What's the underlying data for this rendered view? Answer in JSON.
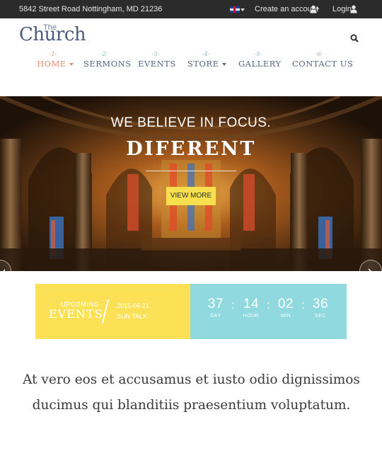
{
  "topbar": {
    "address": "5842 Street Road Nottingham, MD 21236",
    "language_icon": "uk-flag-icon",
    "create_account": "Create an account",
    "create_account_icon": "add-user-icon",
    "login": "Login",
    "login_icon": "user-icon"
  },
  "logo": {
    "small": "The",
    "main": "Church"
  },
  "search_icon": "search-icon",
  "nav": {
    "items": [
      {
        "num": "-1-",
        "label": "HOME"
      },
      {
        "num": "-2-",
        "label": "SERMONS"
      },
      {
        "num": "-3-",
        "label": "EVENTS"
      },
      {
        "num": "-4-",
        "label": "STORE"
      },
      {
        "num": "-5-",
        "label": "GALLERY"
      },
      {
        "num": "-6-",
        "label": "CONTACT US"
      }
    ]
  },
  "hero": {
    "line1": "WE BELIEVE IN FOCUS.",
    "line2": "DIFERENT",
    "button": "VIEW MORE"
  },
  "events": {
    "upcoming": "UPCOMING",
    "title": "EVENTS",
    "date": "2015-06-21",
    "name": "SUN TALK",
    "countdown": [
      {
        "value": "37",
        "label": "DAY"
      },
      {
        "value": "14",
        "label": "HOUR"
      },
      {
        "value": "02",
        "label": "MIN"
      },
      {
        "value": "36",
        "label": "SEC"
      }
    ],
    "separator": ":"
  },
  "quote": "At vero eos et accusamus et iusto odio dignissimos ducimus qui blanditiis praesentium voluptatum.",
  "colors": {
    "topbar_bg": "#2b2b2b",
    "nav_text": "#566584",
    "nav_active": "#e48b6a",
    "nav_number": "#8fb7c7",
    "accent_yellow": "#fce156",
    "accent_teal": "#8fd9df"
  }
}
